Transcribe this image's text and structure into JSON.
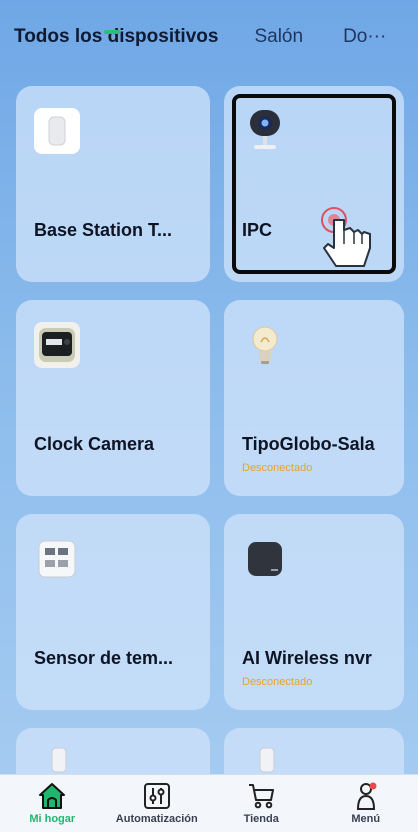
{
  "tabs": {
    "all_devices": "Todos los dispositivos",
    "salon": "Salón",
    "more": "Do···"
  },
  "devices": [
    {
      "name": "Base Station T...",
      "status": "",
      "icon": "base-station-icon"
    },
    {
      "name": "IPC",
      "status": "",
      "icon": "camera-icon"
    },
    {
      "name": "Clock Camera",
      "status": "",
      "icon": "clock-camera-icon"
    },
    {
      "name": "TipoGlobo-Sala",
      "status": "Desconectado",
      "icon": "bulb-icon"
    },
    {
      "name": "Sensor de tem...",
      "status": "",
      "icon": "temperature-sensor-icon"
    },
    {
      "name": "AI Wireless nvr",
      "status": "Desconectado",
      "icon": "nvr-icon"
    }
  ],
  "bottom_nav": {
    "home": "Mi hogar",
    "automation": "Automatización",
    "store": "Tienda",
    "menu": "Menú"
  },
  "colors": {
    "accent": "#1fb66f",
    "status_offline": "#e6a42a",
    "background_top": "#6fa7e6",
    "notification_dot": "#f04848"
  }
}
